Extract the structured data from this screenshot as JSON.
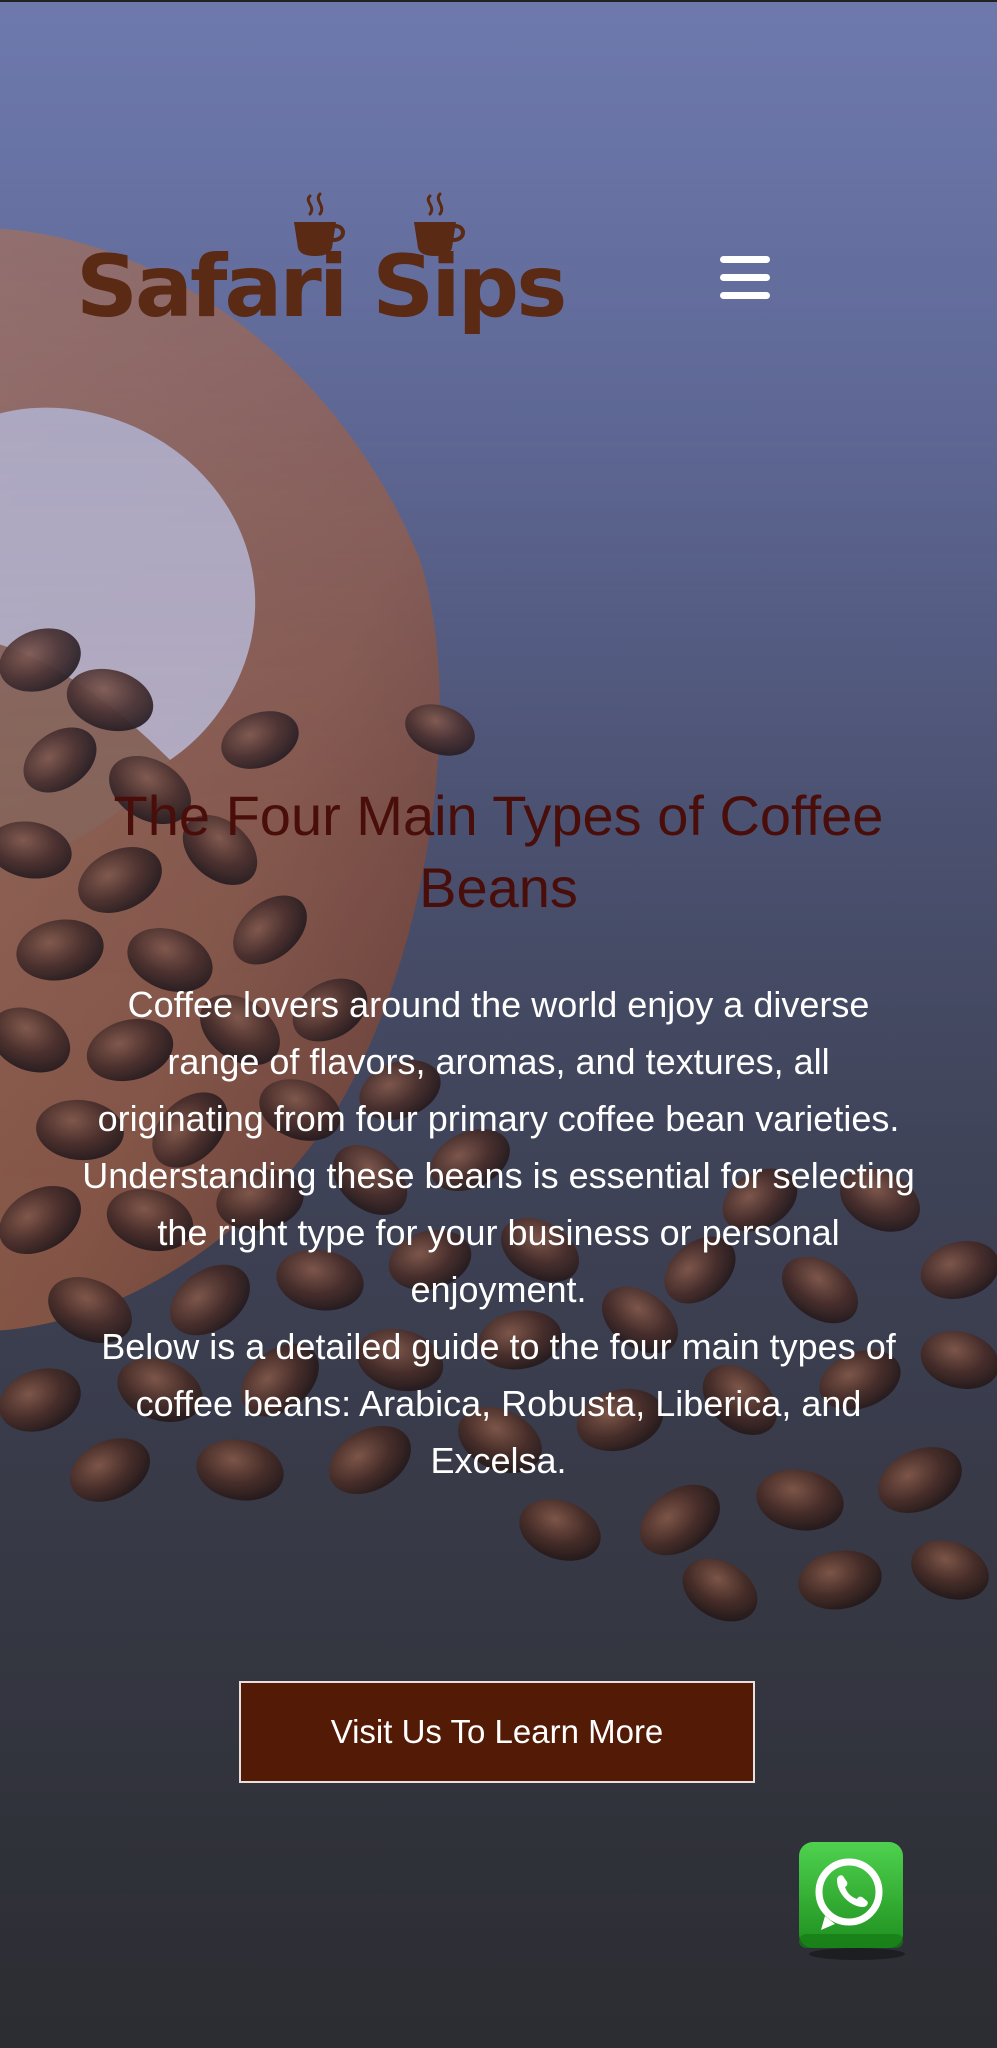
{
  "brand": {
    "name": "Safari Sips",
    "color": "#5a2a14"
  },
  "header": {
    "menu_icon": "hamburger-menu-icon"
  },
  "hero": {
    "title": "The Four Main Types of Coffee Beans",
    "title_color": "#4a0e0a",
    "paragraphs": [
      "Coffee lovers around the world enjoy a diverse range of flavors, aromas, and textures, all originating from four primary coffee bean varieties.",
      "Understanding these beans is essential for selecting the right type for your business or personal enjoyment.",
      "Below is a detailed guide to the four main types of coffee beans: Arabica, Robusta, Liberica, and Excelsa."
    ],
    "cta_label": "Visit Us To Learn More",
    "cta_color": "#531a06"
  },
  "floating": {
    "whatsapp_icon": "whatsapp-icon",
    "whatsapp_color": "#2fb52f"
  }
}
